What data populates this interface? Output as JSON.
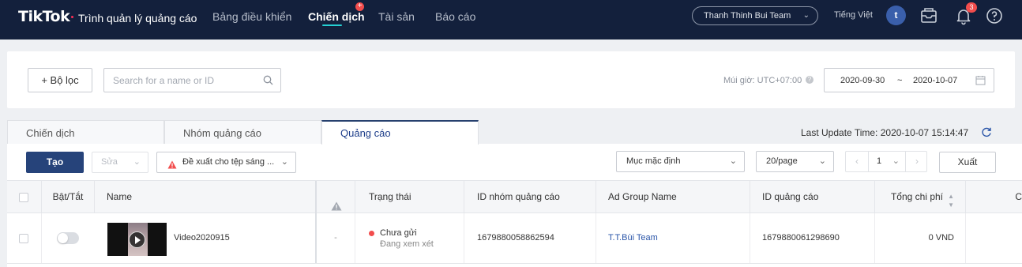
{
  "topbar": {
    "logo": "TikTok",
    "app_name": "Trình quản lý quảng cáo",
    "nav": [
      "Bảng điều khiển",
      "Chiến dịch",
      "Tài sản",
      "Báo cáo"
    ],
    "nav_plus_badge": "+",
    "team": "Thanh Thinh Bui Team",
    "language": "Tiếng Việt",
    "avatar_initial": "t",
    "notification_count": "3"
  },
  "filter": {
    "filter_button": "Bộ lọc",
    "search_placeholder": "Search for a name or ID",
    "timezone": "Múi giờ: UTC+07:00",
    "date_start": "2020-09-30",
    "date_sep": "~",
    "date_end": "2020-10-07"
  },
  "tabs": {
    "items": [
      "Chiến dịch",
      "Nhóm quảng cáo",
      "Quảng cáo"
    ],
    "active": "Quảng cáo",
    "last_update": "Last Update Time: 2020-10-07 15:14:47"
  },
  "toolbar": {
    "create": "Tạo",
    "edit": "Sửa",
    "suggest": "Đề xuất cho tệp sáng ...",
    "column_preset": "Mục mặc định",
    "page_size": "20/page",
    "page": "1",
    "export": "Xuất"
  },
  "table": {
    "columns": [
      "Bật/Tắt",
      "Name",
      "Trạng thái",
      "ID nhóm quảng cáo",
      "Ad Group Name",
      "ID quảng cáo",
      "Tổng chi phí",
      "C"
    ],
    "rows": [
      {
        "enabled": false,
        "name": "Video2020915",
        "warning": "-",
        "status": "Chưa gửi",
        "status_sub": "Đang xem xét",
        "adgroup_id": "1679880058862594",
        "adgroup_name": "T.T.Bùi Team",
        "ad_id": "1679880061298690",
        "cost": "0 VND"
      }
    ]
  },
  "colors": {
    "topbar_bg": "#13203c",
    "primary": "#26437a",
    "danger": "#f24d4d",
    "link": "#2a55a8",
    "nav_underline": "#25d0d4"
  }
}
